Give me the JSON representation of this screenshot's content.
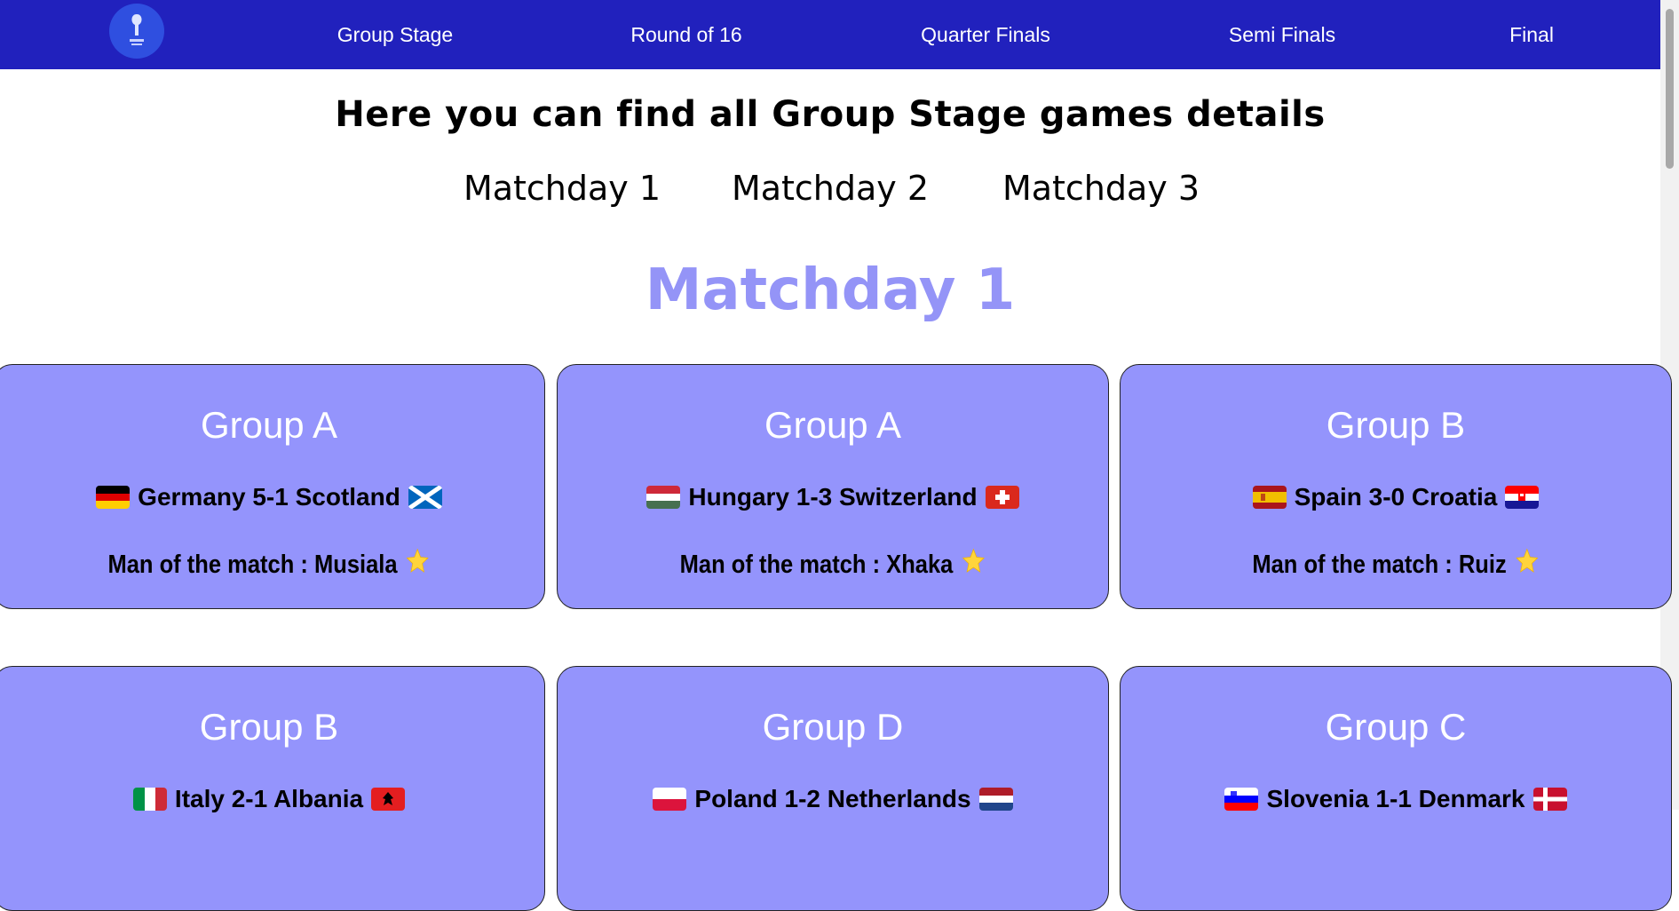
{
  "nav": {
    "logo_icon": "euro2024-logo-icon",
    "links": [
      "Group Stage",
      "Round of 16",
      "Quarter Finals",
      "Semi Finals",
      "Final"
    ]
  },
  "headline": "Here you can find all Group Stage games details",
  "matchdays": [
    "Matchday 1",
    "Matchday 2",
    "Matchday 3"
  ],
  "section_title": "Matchday 1",
  "cards": [
    {
      "group": "Group A",
      "home_flag": "germany-flag-icon",
      "score": "Germany 5-1 Scotland",
      "away_flag": "scotland-flag-icon",
      "motm": "Man of the match : Musiala",
      "icon": "star-icon"
    },
    {
      "group": "Group A",
      "home_flag": "hungary-flag-icon",
      "score": "Hungary 1-3 Switzerland",
      "away_flag": "switzerland-flag-icon",
      "motm": "Man of the match : Xhaka",
      "icon": "star-icon"
    },
    {
      "group": "Group B",
      "home_flag": "spain-flag-icon",
      "score": "Spain 3-0 Croatia",
      "away_flag": "croatia-flag-icon",
      "motm": "Man of the match : Ruiz",
      "icon": "star-icon"
    },
    {
      "group": "Group B",
      "home_flag": "italy-flag-icon",
      "score": "Italy 2-1 Albania",
      "away_flag": "albania-flag-icon"
    },
    {
      "group": "Group D",
      "home_flag": "poland-flag-icon",
      "score": "Poland 1-2 Netherlands",
      "away_flag": "netherlands-flag-icon"
    },
    {
      "group": "Group C",
      "home_flag": "slovenia-flag-icon",
      "score": "Slovenia 1-1 Denmark",
      "away_flag": "denmark-flag-icon"
    }
  ],
  "colors": {
    "nav": "#2121bd",
    "card": "#9494fc",
    "section_title": "#9494f7"
  }
}
